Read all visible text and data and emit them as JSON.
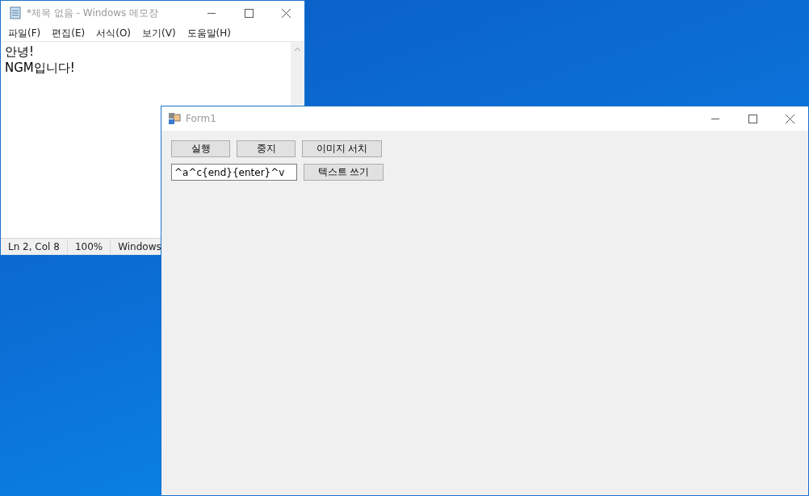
{
  "notepad": {
    "title": "*제목 없음 - Windows 메모장",
    "menu": [
      "파일(F)",
      "편집(E)",
      "서식(O)",
      "보기(V)",
      "도움말(H)"
    ],
    "lines": [
      "안녕!",
      "NGM입니다!"
    ],
    "status_bar": [
      "Ln 2, Col 8",
      "100%",
      "Windows"
    ]
  },
  "form": {
    "title": "Form1",
    "buttons_row1": [
      "실행",
      "중지",
      "이미지 서치"
    ],
    "text_field": {
      "value": "^a^c{end}{enter}^v"
    },
    "button_row2": "텍스트 쓰기"
  }
}
